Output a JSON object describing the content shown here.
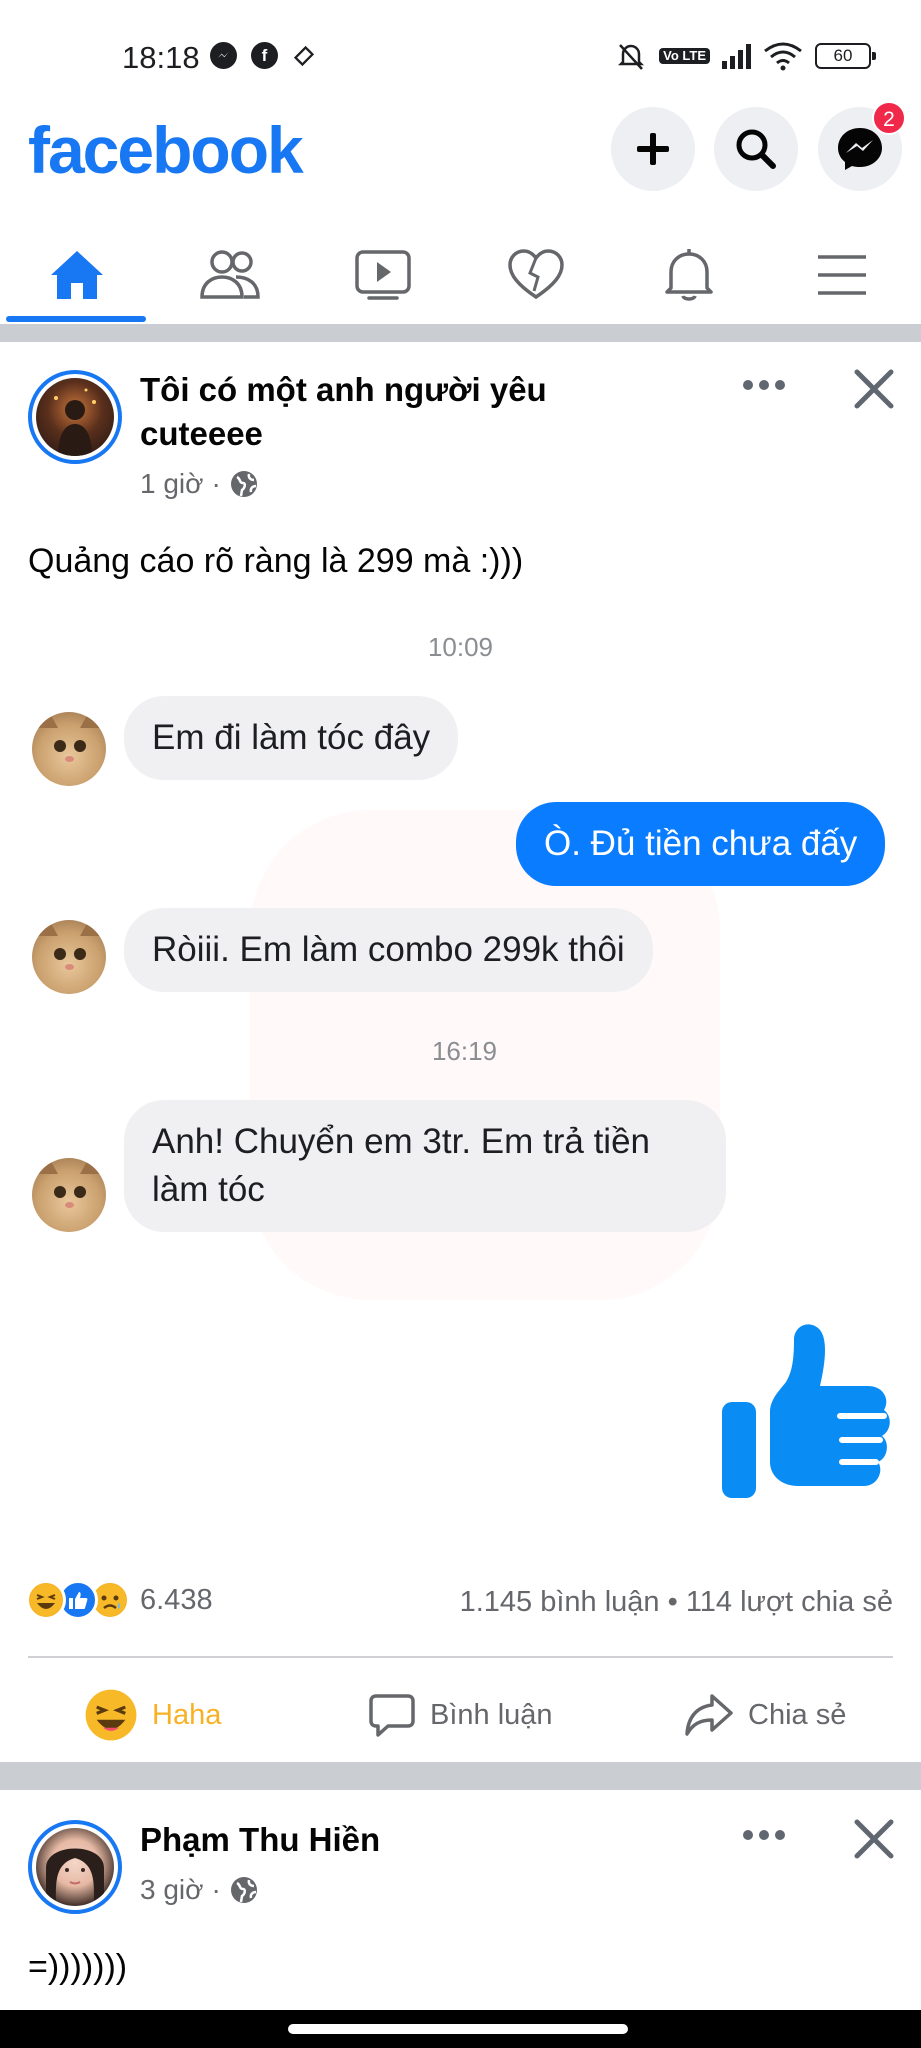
{
  "status_bar": {
    "time": "18:18",
    "left_icons": [
      "messenger-icon",
      "facebook-icon",
      "diamond-icon"
    ],
    "right_icons": [
      "mute-icon",
      "volte-icon",
      "signal-icon",
      "wifi-icon",
      "battery-icon"
    ],
    "volte_label": "Vo LTE",
    "battery": "60"
  },
  "header": {
    "logo": "facebook",
    "create_icon": "plus-icon",
    "search_icon": "search-icon",
    "messenger_badge": "2"
  },
  "nav": {
    "tabs": [
      {
        "name": "home",
        "icon": "home-icon",
        "active": true
      },
      {
        "name": "friends",
        "icon": "friends-icon"
      },
      {
        "name": "watch",
        "icon": "video-icon"
      },
      {
        "name": "dating",
        "icon": "heart-icon"
      },
      {
        "name": "notifications",
        "icon": "bell-icon"
      },
      {
        "name": "menu",
        "icon": "hamburger-icon"
      }
    ],
    "accent": "#1877f2"
  },
  "post1": {
    "author": "Tôi có một anh người yêu cuteeee",
    "time": "1 giờ",
    "separator": "·",
    "caption": "Quảng cáo rõ ràng là 299 mà :)))",
    "chat": {
      "time_1": "10:09",
      "msg_1": "Em đi làm tóc đây",
      "msg_2": "Ò. Đủ tiền chưa đấy",
      "msg_3": "Ròiii. Em làm combo 299k thôi",
      "time_2": "16:19",
      "msg_4": "Anh! Chuyển em 3tr. Em trả tiền làm tóc",
      "sent_bubble_color": "#0a7cff",
      "thumb_color": "#0a8cf5"
    },
    "reactions_count": "6.438",
    "comments": "1.145 bình luận",
    "stats_separator": "•",
    "shares": "114 lượt chia sẻ",
    "actions": {
      "haha": "Haha",
      "comment": "Bình luận",
      "share": "Chia sẻ"
    }
  },
  "post2": {
    "author": "Phạm Thu Hiền",
    "time": "3 giờ",
    "separator": "·",
    "caption": "=)))))))"
  }
}
